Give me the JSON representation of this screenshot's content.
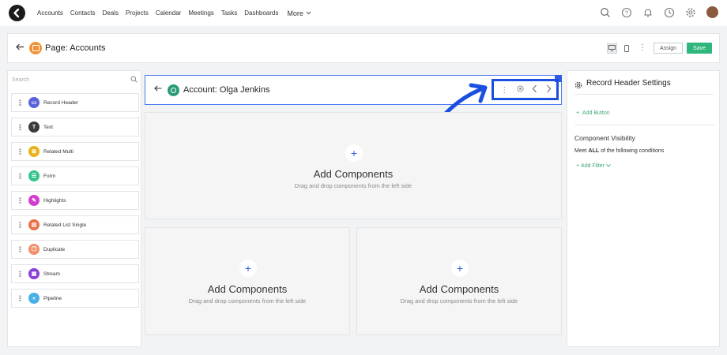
{
  "topnav": {
    "links": [
      "Accounts",
      "Contacts",
      "Deals",
      "Projects",
      "Calendar",
      "Meetings",
      "Tasks",
      "Dashboards"
    ],
    "more_label": "More",
    "icons": [
      "search-icon",
      "help-icon",
      "bell-icon",
      "clock-icon",
      "gear-icon"
    ]
  },
  "page_header": {
    "title": "Page: Accounts",
    "assign_label": "Assign",
    "save_label": "Save",
    "save_color": "#2fb67c"
  },
  "left_panel": {
    "search_placeholder": "Search",
    "components": [
      {
        "label": "Record Header",
        "color": "#5a64d8",
        "glyph": "▭"
      },
      {
        "label": "Text",
        "color": "#3a3a3a",
        "glyph": "T"
      },
      {
        "label": "Related Multi",
        "color": "#e8b21a",
        "glyph": "⊠"
      },
      {
        "label": "Form",
        "color": "#35c48a",
        "glyph": "☰"
      },
      {
        "label": "Highlights",
        "color": "#d23fd0",
        "glyph": "✎"
      },
      {
        "label": "Related List Single",
        "color": "#e8734a",
        "glyph": "▤"
      },
      {
        "label": "Duplicate",
        "color": "#f08f6a",
        "glyph": "❐"
      },
      {
        "label": "Stream",
        "color": "#8a3fd8",
        "glyph": "▦"
      },
      {
        "label": "Pipeline",
        "color": "#4aaee8",
        "glyph": "»"
      }
    ]
  },
  "canvas": {
    "record_header_title": "Account: Olga Jenkins",
    "dropzone_title": "Add Components",
    "dropzone_subtitle": "Drag and drop components from the left side"
  },
  "right_panel": {
    "title": "Record Header Settings",
    "add_button_label": "Add Button",
    "visibility_title": "Component Visibility",
    "condition_prefix": "Meet",
    "condition_bold": "ALL",
    "condition_suffix": "of the following conditions",
    "add_filter_label": "Add Filter"
  },
  "colors": {
    "accent_blue": "#2d5be3",
    "highlight_border": "#1a4fe0",
    "link_green": "#3fa776"
  }
}
